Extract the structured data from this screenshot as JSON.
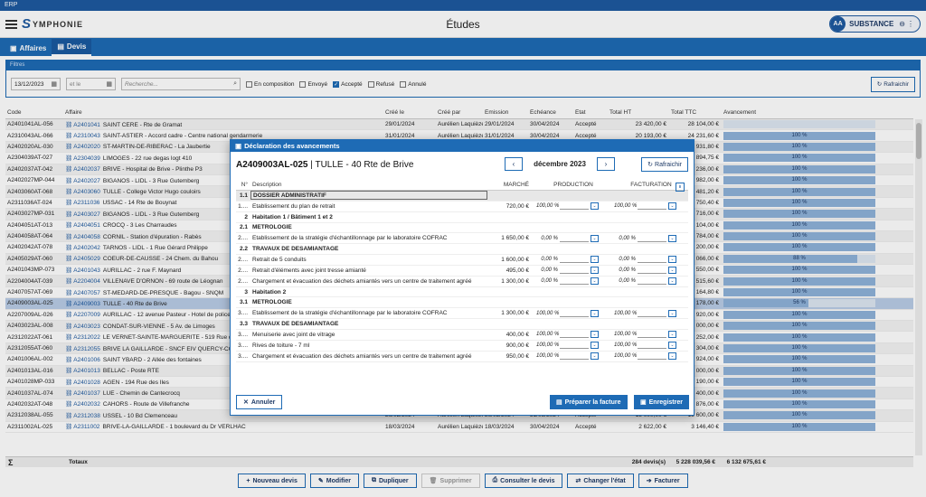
{
  "window_title": "ERP",
  "app": {
    "logo_letter": "S",
    "logo_text": "YMPHONIE",
    "title": "Études"
  },
  "user": {
    "initials": "AA",
    "name": "SUBSTANCE",
    "icons": [
      "⊖",
      "⋮"
    ]
  },
  "tabs": [
    {
      "icon": "▣",
      "label": "Affaires"
    },
    {
      "icon": "▤",
      "label": "Devis"
    }
  ],
  "filters": {
    "title": "Filtres",
    "date_from": "13/12/2023",
    "date_to_placeholder": "et le",
    "search_placeholder": "Recherche...",
    "statuses": [
      {
        "label": "En composition",
        "checked": false
      },
      {
        "label": "Envoyé",
        "checked": false
      },
      {
        "label": "Accepté",
        "checked": true
      },
      {
        "label": "Refusé",
        "checked": false
      },
      {
        "label": "Annulé",
        "checked": false
      }
    ],
    "refresh_label": "Rafraichir"
  },
  "grid": {
    "headers": [
      "Code",
      "Affaire",
      "Créé le",
      "Créé par",
      "Émission",
      "Échéance",
      "État",
      "Total HT",
      "Total TTC",
      "Avancement"
    ],
    "rows": [
      [
        "A2401041AL-056",
        "A2401041",
        "SAINT CERE - Rte de Gramat",
        "29/01/2024",
        "Aurélien Laquièze",
        "29/01/2024",
        "30/04/2024",
        "Accepté",
        "23 420,00 €",
        "28 104,00 €",
        ""
      ],
      [
        "A2310043AL-066",
        "A2310043",
        "SAINT-ASTIER - Accord cadre - Centre national gendarmerie",
        "31/01/2024",
        "Aurélien Laquièze",
        "31/01/2024",
        "30/04/2024",
        "Accepté",
        "20 193,00 €",
        "24 231,60 €",
        "100 %"
      ],
      [
        "A2402020AL-030",
        "A2402020",
        "ST-MARTIN-DE-RIBERAC - La Jaubertie",
        "",
        "",
        "",
        "",
        "",
        "",
        "33 931,80 €",
        "100 %"
      ],
      [
        "A2304039AT-027",
        "A2304039",
        "LIMOGES - 22 rue degas logt 410",
        "",
        "",
        "",
        "",
        "",
        "",
        "20 894,75 €",
        "100 %"
      ],
      [
        "A2402037AT-042",
        "A2402037",
        "BRIVE - Hospital de Brive - Plinthe P3",
        "",
        "",
        "",
        "",
        "",
        "",
        "7 236,00 €",
        "100 %"
      ],
      [
        "A2402027MP-044",
        "A2402027",
        "BIGANOS - LIDL - 3 Rue Gutemberg",
        "",
        "",
        "",
        "",
        "",
        "",
        "14 982,00 €",
        "100 %"
      ],
      [
        "A2403060AT-068",
        "A2403060",
        "TULLE - College Victor Hugo couloirs",
        "",
        "",
        "",
        "",
        "",
        "",
        "57 481,20 €",
        "100 %"
      ],
      [
        "A2311036AT-024",
        "A2311036",
        "USSAC - 14 Rte de Bouynat",
        "",
        "",
        "",
        "",
        "",
        "",
        "11 750,40 €",
        "100 %"
      ],
      [
        "A2403027MP-031",
        "A2403027",
        "BIGANOS - LIDL - 3 Rue Gutemberg",
        "",
        "",
        "",
        "",
        "",
        "",
        "4 716,00 €",
        "100 %"
      ],
      [
        "A2404051AT-013",
        "A2404051",
        "CROCQ - 3 Les Charraudes",
        "",
        "",
        "",
        "",
        "",
        "",
        "19 104,00 €",
        "100 %"
      ],
      [
        "A2404058AT-064",
        "A2404058",
        "CORNIL - Station d'épuration - Rabès",
        "",
        "",
        "",
        "",
        "",
        "",
        "17 784,00 €",
        "100 %"
      ],
      [
        "A2402042AT-078",
        "A2402042",
        "TARNOS - LIDL - 1 Rue Gérard Philippe",
        "",
        "",
        "",
        "",
        "",
        "",
        "13 200,00 €",
        "100 %"
      ],
      [
        "A2405029AT-060",
        "A2405029",
        "COEUR-DE-CAUSSE - 24 Chem. du Bahou",
        "",
        "",
        "",
        "",
        "",
        "",
        "12 066,00 €",
        "88 %"
      ],
      [
        "A2401043MP-073",
        "A2401043",
        "AURILLAC - 2 rue F. Maynard",
        "",
        "",
        "",
        "",
        "",
        "",
        "11 550,00 €",
        "100 %"
      ],
      [
        "A2204004AT-039",
        "A2204004",
        "VILLENAVE D'ORNON - 69 route de Léognan",
        "",
        "",
        "",
        "",
        "",
        "",
        "7 515,60 €",
        "100 %"
      ],
      [
        "A2407057AT-069",
        "A2407057",
        "ST-MEDARD-DE-PRESQUE - Bagou - SNQM",
        "",
        "",
        "",
        "",
        "",
        "",
        "35 164,80 €",
        "100 %"
      ],
      [
        "A2409003AL-025",
        "A2409003",
        "TULLE - 40 Rte de Brive",
        "",
        "",
        "",
        "",
        "",
        "",
        "11 178,00 €",
        "56 %"
      ],
      [
        "A2207009AL-026",
        "A2207009",
        "AURILLAC - 12 avenue Pasteur - Hotel de police",
        "",
        "",
        "",
        "",
        "",
        "",
        "16 920,00 €",
        "100 %"
      ],
      [
        "A2403023AL-008",
        "A2403023",
        "CONDAT-SUR-VIENNE - 5 Av. de Limoges",
        "",
        "",
        "",
        "",
        "",
        "",
        "24 000,00 €",
        "100 %"
      ],
      [
        "A2312022AT-061",
        "A2312022",
        "LE VERNET-SAINTE-MARGUERITE - 519 Rue de...",
        "",
        "",
        "",
        "",
        "",
        "",
        "15 252,00 €",
        "100 %"
      ],
      [
        "A2312055AT-060",
        "A2312055",
        "BRIVE LA GAILLARDE - SNCF EIV QUERCY-CORREZE",
        "",
        "",
        "",
        "",
        "",
        "",
        "17 304,00 €",
        "100 %"
      ],
      [
        "A2401006AL-002",
        "A2401006",
        "SAINT YBARD - 2 Allée des fontaines",
        "",
        "",
        "",
        "",
        "",
        "",
        "18 924,00 €",
        "100 %"
      ],
      [
        "A2401013AL-016",
        "A2401013",
        "BELLAC - Poste RTE",
        "",
        "",
        "",
        "",
        "",
        "",
        "12 000,00 €",
        "100 %"
      ],
      [
        "A2401028MP-033",
        "A2401028",
        "AGEN - 194 Rue des Iles",
        "",
        "",
        "",
        "",
        "",
        "",
        "8 190,00 €",
        "100 %"
      ],
      [
        "A2401037AL-074",
        "A2401037",
        "LUE - Chemin de Cantecrocq",
        "",
        "",
        "",
        "",
        "",
        "",
        "2 400,00 €",
        "100 %"
      ],
      [
        "A2402032AT-048",
        "A2402032",
        "CAHORS - Route de Villefranche",
        "15/02/2024",
        "Aymeric Texier",
        "20/02/2024",
        "31/05/2024",
        "Accepté",
        "8 230,00 €",
        "9 876,00 €",
        "100 %"
      ],
      [
        "A2312038AL-055",
        "A2312038",
        "USSEL - 10 Bd Clemenceau",
        "26/02/2024",
        "Aurélien Laquièze",
        "26/02/2024",
        "31/05/2024",
        "Accepté",
        "13 000,00 €",
        "15 600,00 €",
        "100 %"
      ],
      [
        "A2311002AL-025",
        "A2311002",
        "BRIVE-LA-GAILLARDE - 1 boulevard du Dr VERLHAC",
        "18/03/2024",
        "Aurélien Laquièze",
        "18/03/2024",
        "30/04/2024",
        "Accepté",
        "2 622,00 €",
        "3 146,40 €",
        "100 %"
      ]
    ],
    "progress": [
      0,
      100,
      100,
      100,
      100,
      100,
      100,
      100,
      100,
      100,
      100,
      100,
      88,
      100,
      100,
      100,
      56,
      100,
      100,
      100,
      100,
      100,
      100,
      100,
      100,
      100,
      100,
      100
    ],
    "selected_index": 16,
    "totals": {
      "sigma": "Σ",
      "label": "Totaux",
      "count": "284 devis(s)",
      "total_ht": "5 228 039,56 €",
      "total_ttc": "6 132 675,61 €"
    }
  },
  "footer_buttons": [
    {
      "icon": "+",
      "label": "Nouveau devis",
      "disabled": false
    },
    {
      "icon": "✎",
      "label": "Modifier",
      "disabled": false
    },
    {
      "icon": "⧉",
      "label": "Dupliquer",
      "disabled": false
    },
    {
      "icon": "🗑",
      "label": "Supprimer",
      "disabled": true
    },
    {
      "icon": "⎙",
      "label": "Consulter le devis",
      "disabled": false
    },
    {
      "icon": "⇄",
      "label": "Changer l'état",
      "disabled": false
    },
    {
      "icon": "➔",
      "label": "Facturer",
      "disabled": false
    }
  ],
  "modal": {
    "title": "Déclaration des avancements",
    "ref_code": "A2409003AL-025",
    "ref_name": "| TULLE - 40 Rte de Brive",
    "month": "décembre 2023",
    "refresh_label": "Rafraichir",
    "headers": [
      "N°",
      "Description",
      "MARCHÉ",
      "PRODUCTION",
      "FACTURATION"
    ],
    "rows": [
      {
        "n": "1.1",
        "desc": "DOSSIER ADMINISTRATIF",
        "sec": true,
        "hl": true
      },
      {
        "n": "1....",
        "desc": "Etablissement du plan de retrait",
        "marche": "720,00 €",
        "prod": "100,00 %",
        "fact": "100,00 %"
      },
      {
        "n": "2",
        "desc": "Habitation 1 / Bâtiment 1 et 2",
        "sec": true
      },
      {
        "n": "2.1",
        "desc": "METROLOGIE",
        "sec": true
      },
      {
        "n": "2....",
        "desc": "Etablissement de la stratégie d'échantillonnage par le laboratoire COFRAC",
        "marche": "1 650,00 €",
        "prod": "0,00 %",
        "fact": "0,00 %"
      },
      {
        "n": "2.2",
        "desc": "TRAVAUX DE DESAMIANTAGE",
        "sec": true
      },
      {
        "n": "2....",
        "desc": "Retrait de 5 conduits",
        "marche": "1 600,00 €",
        "prod": "0,00 %",
        "fact": "0,00 %"
      },
      {
        "n": "2....",
        "desc": "Retrait d'éléments avec joint tresse amianté",
        "marche": "495,00 €",
        "prod": "0,00 %",
        "fact": "0,00 %"
      },
      {
        "n": "2....",
        "desc": "Chargement et évacuation des déchets amiantés vers un centre de traitement agréé",
        "marche": "1 300,00 €",
        "prod": "0,00 %",
        "fact": "0,00 %"
      },
      {
        "n": "3",
        "desc": "Habitation 2",
        "sec": true
      },
      {
        "n": "3.1",
        "desc": "METROLOGIE",
        "sec": true
      },
      {
        "n": "3....",
        "desc": "Etablissement de la stratégie d'échantillonnage par le laboratoire COFRAC",
        "marche": "1 300,00 €",
        "prod": "100,00 %",
        "fact": "100,00 %"
      },
      {
        "n": "3.3",
        "desc": "TRAVAUX DE DESAMIANTAGE",
        "sec": true
      },
      {
        "n": "3....",
        "desc": "Menuiserie avec joint de vitrage",
        "marche": "400,00 €",
        "prod": "100,00 %",
        "fact": "100,00 %"
      },
      {
        "n": "3....",
        "desc": "Rives de toiture - 7 ml",
        "marche": "900,00 €",
        "prod": "100,00 %",
        "fact": "100,00 %"
      },
      {
        "n": "3....",
        "desc": "Chargement et évacuation des déchets amiantés vers un centre de traitement agréé",
        "marche": "950,00 €",
        "prod": "100,00 %",
        "fact": "100,00 %"
      }
    ],
    "cancel_label": "Annuler",
    "bill_label": "Préparer la facture",
    "save_label": "Enregistrer"
  },
  "colors": {
    "accent": "#1e6bb5",
    "title_bar": "#1e5aa0",
    "progress": "#8fb2d9",
    "selected_row": "#b9cde6"
  }
}
